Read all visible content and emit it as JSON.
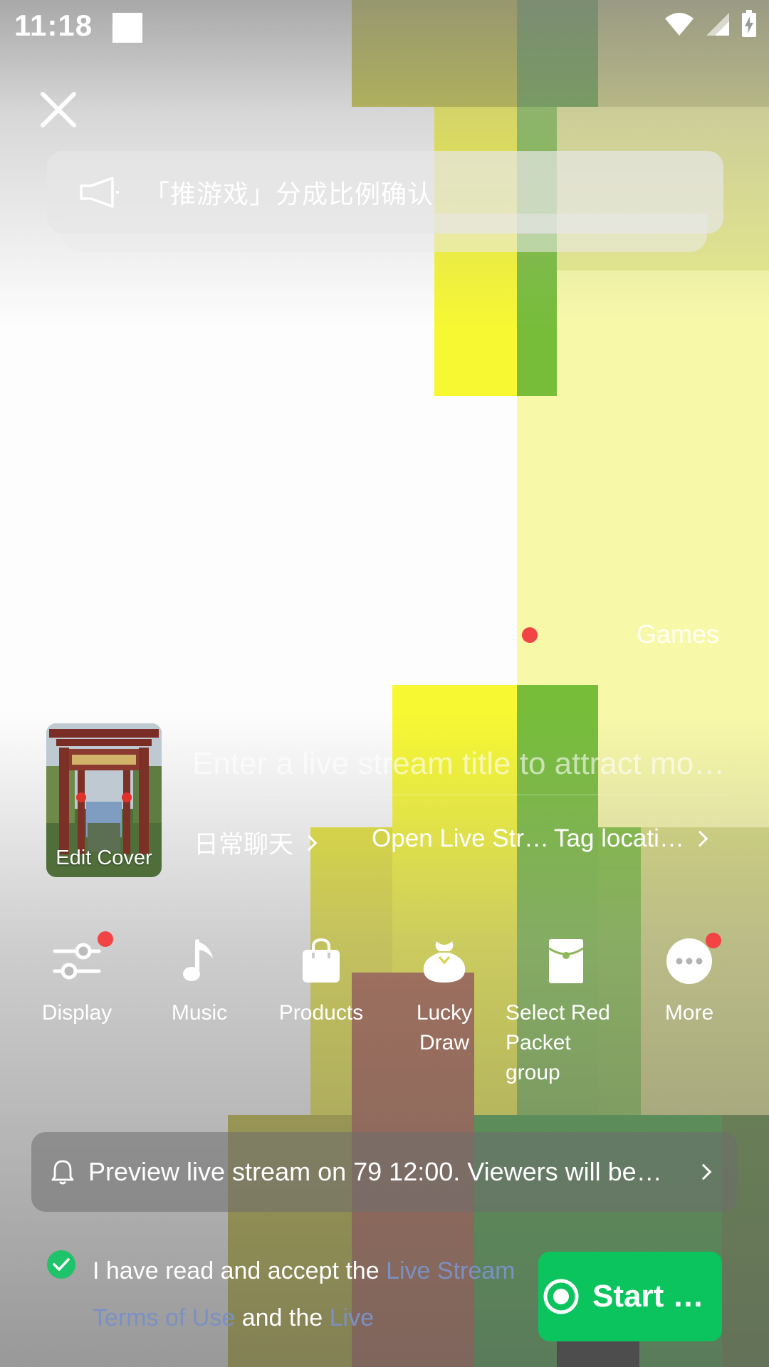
{
  "status_bar": {
    "time": "11:18"
  },
  "announcement": {
    "text": "「推游戏」分成比例确认"
  },
  "games": {
    "label": "Games"
  },
  "cover": {
    "label": "Edit Cover"
  },
  "title_input": {
    "placeholder": "Enter a live stream title to attract more viewers"
  },
  "options": [
    {
      "label": "日常聊天"
    },
    {
      "label": "Open Live Str…"
    },
    {
      "label": "Tag locati…"
    }
  ],
  "tools": [
    {
      "label": "Display",
      "icon": "sliders-icon",
      "badge": true
    },
    {
      "label": "Music",
      "icon": "music-note-icon",
      "badge": false
    },
    {
      "label": "Products",
      "icon": "shopping-bag-icon",
      "badge": false
    },
    {
      "label": "Lucky Draw",
      "icon": "lucky-bag-icon",
      "badge": false
    },
    {
      "label": "Select Red Packet group",
      "icon": "red-packet-icon",
      "badge": false
    },
    {
      "label": "More",
      "icon": "more-dots-icon",
      "badge": true
    }
  ],
  "preview_banner": {
    "text": "Preview live stream on 79 12:00. Viewers will be…"
  },
  "agreement": {
    "prefix": "I have read and accept the ",
    "link1": "Live Stream Terms of Use",
    "middle": " and the ",
    "link2": "Live",
    "checked": true
  },
  "start_button": {
    "label": "Start Li…"
  },
  "colors": {
    "accent": "#0cc45e",
    "link": "#7b90c4",
    "badge": "#f24444"
  }
}
